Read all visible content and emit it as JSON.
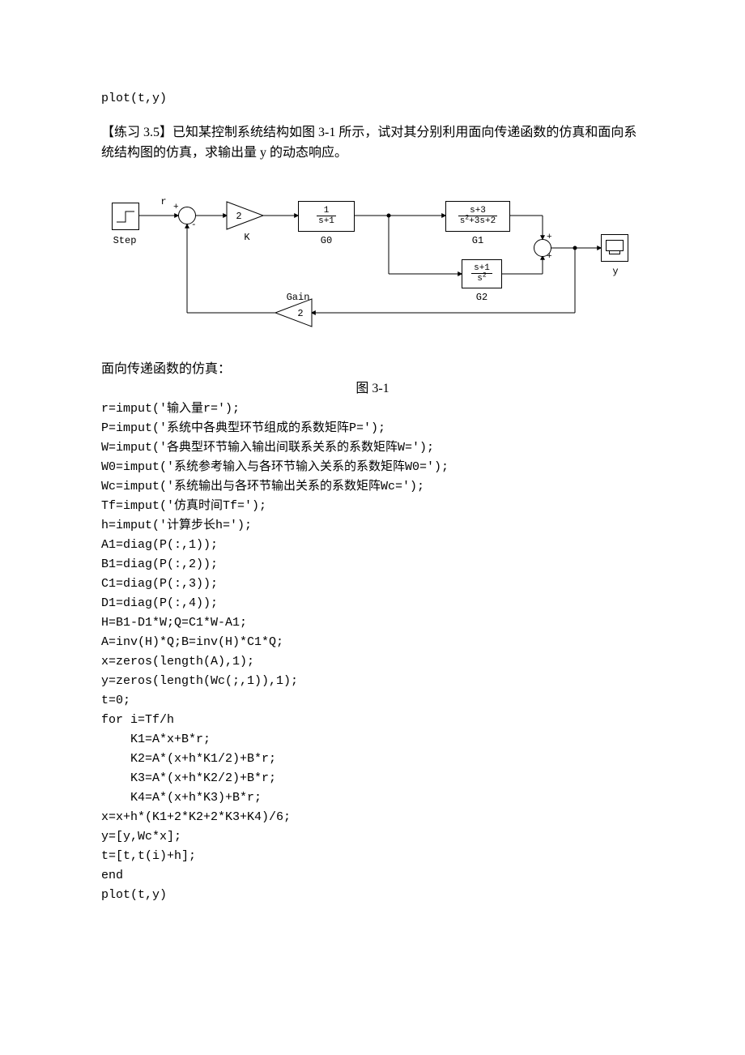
{
  "code_top": "plot(t,y)",
  "exercise_text": "【练习 3.5】已知某控制系统结构如图 3-1 所示，试对其分别利用面向传递函数的仿真和面向系统结构图的仿真，求输出量 y 的动态响应。",
  "diagram": {
    "labels": {
      "step": "Step",
      "r": "r",
      "K": "K",
      "K_val": "2",
      "G0": "G0",
      "G0_num": "1",
      "G0_den": "s+1",
      "G1": "G1",
      "G1_num": "s+3",
      "G1_den_pre": "s",
      "G1_den_exp": "2",
      "G1_den_rest": "+3s+2",
      "G2": "G2",
      "G2_num": "s+1",
      "G2_den_pre": "s",
      "G2_den_exp": "2",
      "gain": "Gain",
      "gain_val": "2",
      "y": "y"
    }
  },
  "section_title": "面向传递函数的仿真：",
  "fig_caption": "图 3-1",
  "code_lines": [
    "r=imput('输入量r=');",
    "P=imput('系统中各典型环节组成的系数矩阵P=');",
    "W=imput('各典型环节输入输出间联系关系的系数矩阵W=');",
    "W0=imput('系统参考输入与各环节输入关系的系数矩阵W0=');",
    "Wc=imput('系统输出与各环节输出关系的系数矩阵Wc=');",
    "Tf=imput('仿真时间Tf=');",
    "h=imput('计算步长h=');",
    "A1=diag(P(:,1));",
    "B1=diag(P(:,2));",
    "C1=diag(P(:,3));",
    "D1=diag(P(:,4));",
    "H=B1-D1*W;Q=C1*W-A1;",
    "A=inv(H)*Q;B=inv(H)*C1*Q;",
    "x=zeros(length(A),1);",
    "y=zeros(length(Wc(;,1)),1);",
    "t=0;",
    "for i=Tf/h",
    "    K1=A*x+B*r;",
    "    K2=A*(x+h*K1/2)+B*r;",
    "    K3=A*(x+h*K2/2)+B*r;",
    "    K4=A*(x+h*K3)+B*r;",
    "x=x+h*(K1+2*K2+2*K3+K4)/6;",
    "y=[y,Wc*x];",
    "t=[t,t(i)+h];",
    "end",
    "plot(t,y)"
  ]
}
